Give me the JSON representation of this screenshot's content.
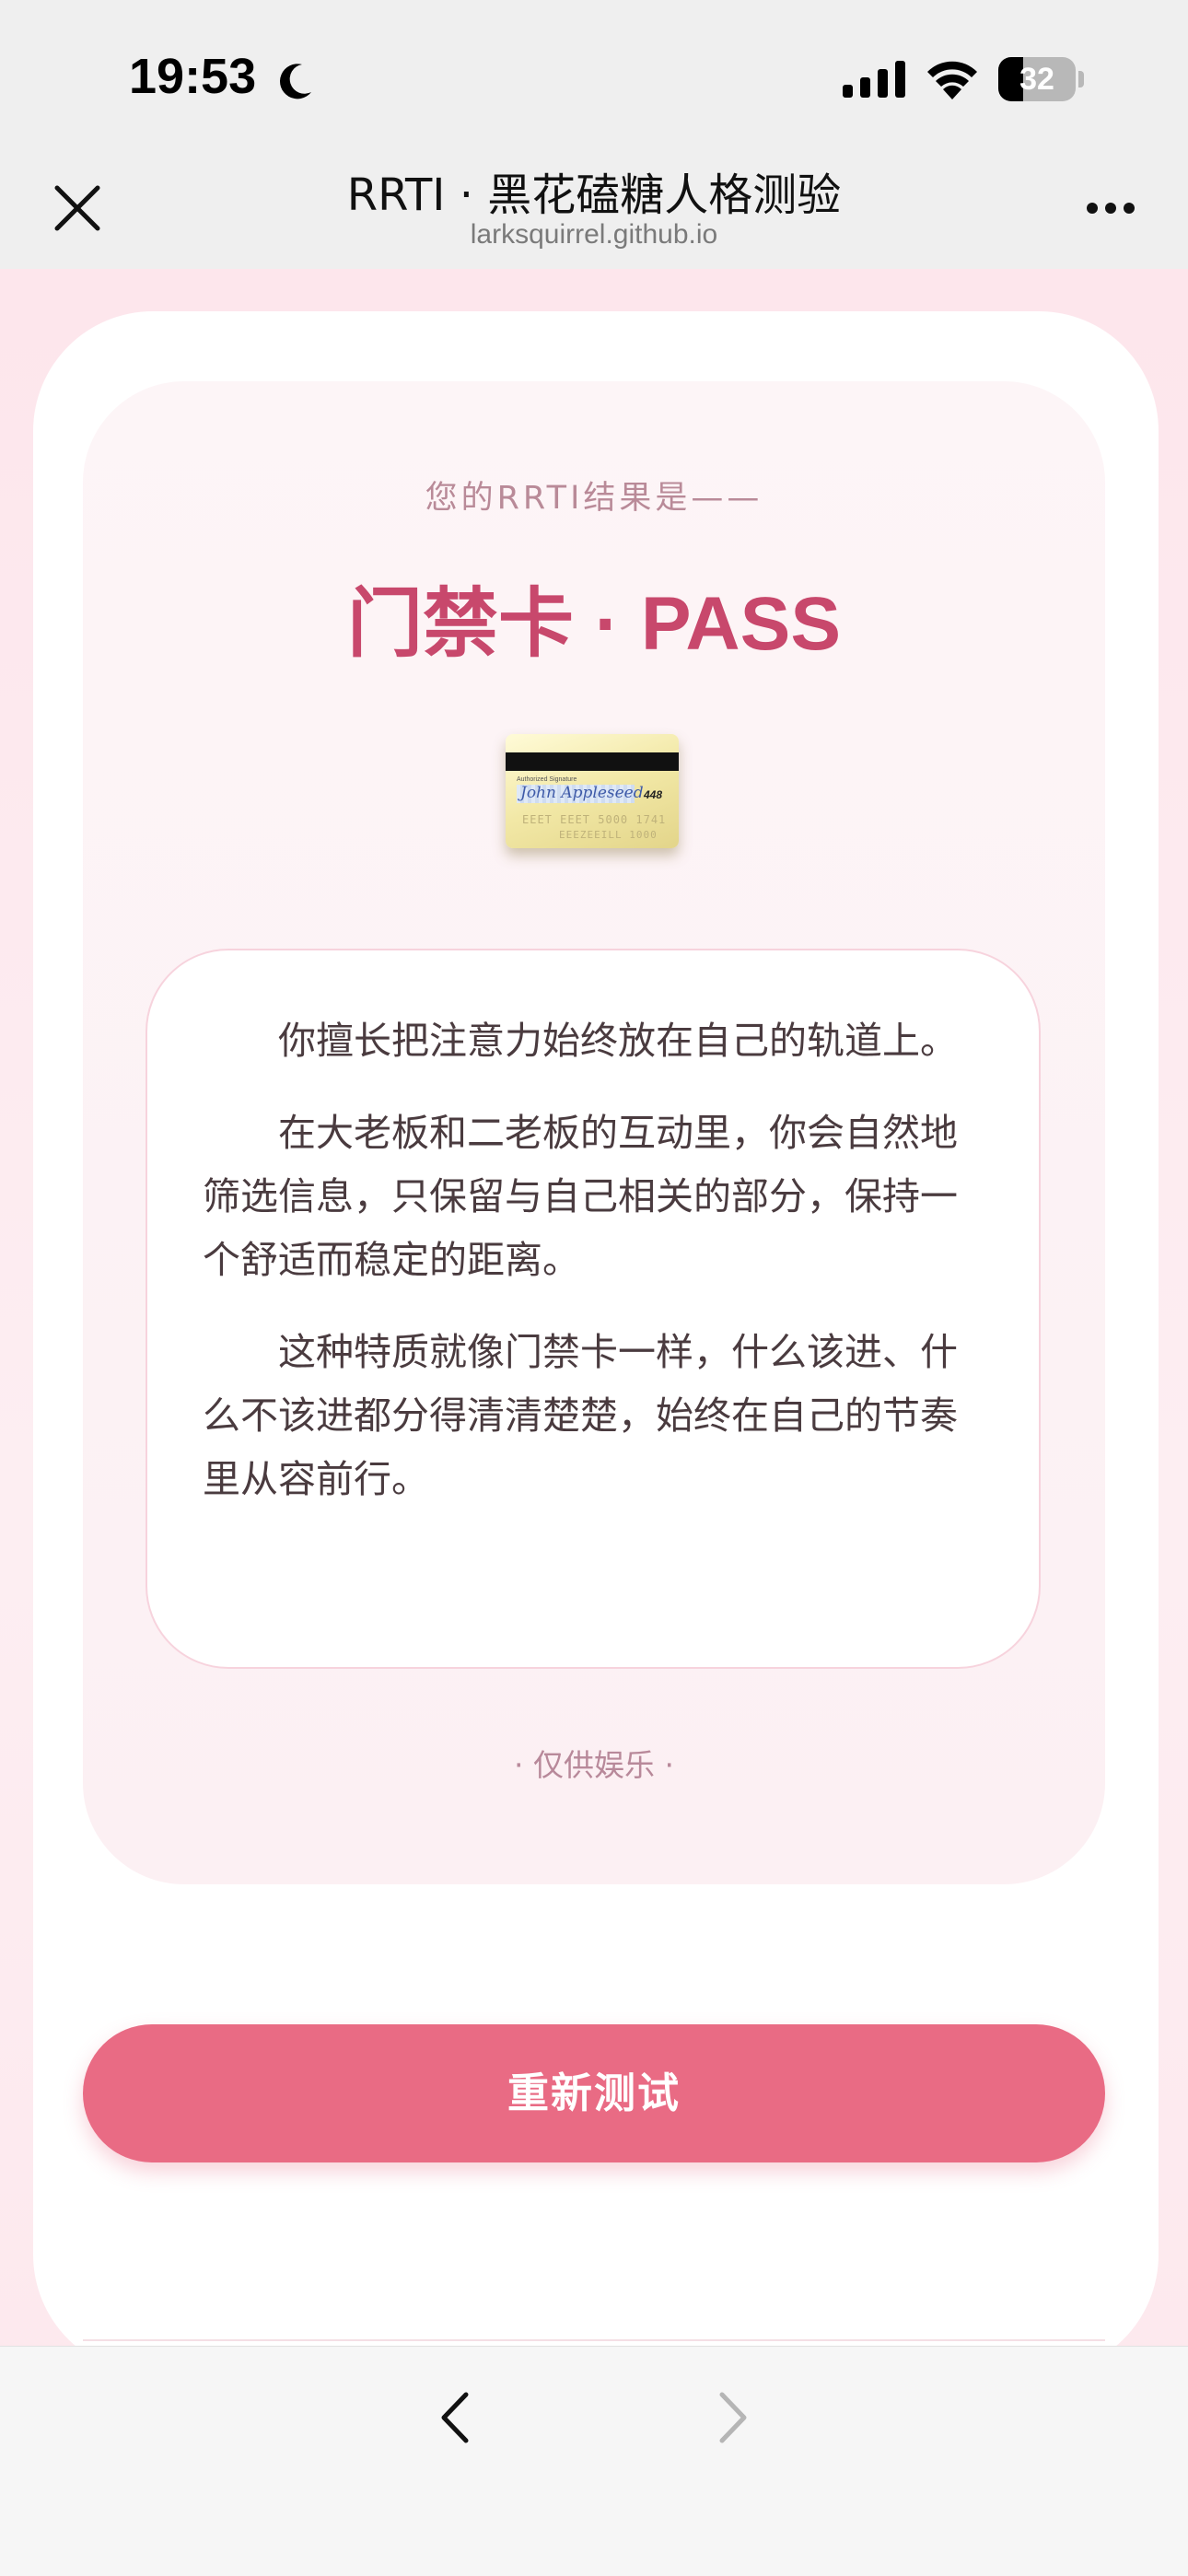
{
  "status_bar": {
    "time": "19:53",
    "battery_level": "32",
    "battery_fraction": 0.32,
    "icons": [
      "moon-icon",
      "cellular-signal-icon",
      "wifi-icon",
      "battery-icon"
    ]
  },
  "browser": {
    "title": "RRTI · 黑花磕糖人格测验",
    "url": "larksquirrel.github.io",
    "icons": [
      "close-icon",
      "more-icon",
      "back-arrow-icon",
      "forward-arrow-icon"
    ]
  },
  "result": {
    "label": "您的RRTI结果是——",
    "name": "门禁卡 · PASS",
    "image": {
      "subject": "credit-card-icon",
      "signature_label": "Authorized Signature",
      "signature": "John Appleseed",
      "cvv": "448",
      "number_line_1": "EEET EEET 5000 1741",
      "number_line_2": "EEEZEEILL 1000"
    },
    "paragraphs": [
      "你擅长把注意力始终放在自己的轨道上。",
      "在大老板和二老板的互动里，你会自然地筛选信息，只保留与自己相关的部分，保持一个舒适而稳定的距离。",
      "这种特质就像门禁卡一样，什么该进、什么不该进都分得清清楚楚，始终在自己的节奏里从容前行。"
    ],
    "disclaimer": "· 仅供娱乐 ·"
  },
  "actions": {
    "retry_label": "重新测试"
  },
  "colors": {
    "accent": "#c8486c",
    "button": "#e96b84",
    "page_background": "#fde9ee",
    "label": "#b98a98"
  }
}
